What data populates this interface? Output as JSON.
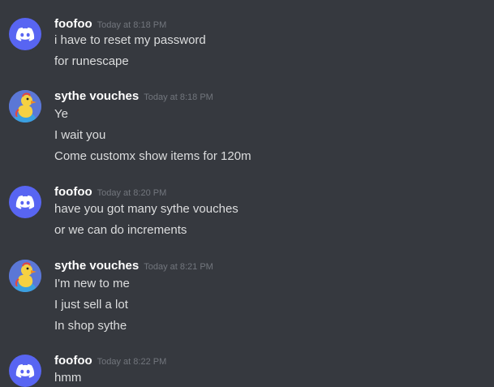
{
  "messages": [
    {
      "avatar": "discord-logo-icon",
      "username": "foofoo",
      "timestamp": "Today at 8:18 PM",
      "lines": [
        "i have to reset my password",
        "for runescape"
      ]
    },
    {
      "avatar": "duck-avatar-icon",
      "username": "sythe vouches",
      "timestamp": "Today at 8:18 PM",
      "lines": [
        "Ye",
        "I wait you",
        "Come customx show items for 120m"
      ]
    },
    {
      "avatar": "discord-logo-icon",
      "username": "foofoo",
      "timestamp": "Today at 8:20 PM",
      "lines": [
        "have you got many sythe vouches",
        "or we can do increments"
      ]
    },
    {
      "avatar": "duck-avatar-icon",
      "username": "sythe vouches",
      "timestamp": "Today at 8:21 PM",
      "lines": [
        "I'm new to me",
        "I just sell a lot",
        "In shop sythe"
      ]
    },
    {
      "avatar": "discord-logo-icon",
      "username": "foofoo",
      "timestamp": "Today at 8:22 PM",
      "lines": [
        "hmm"
      ]
    }
  ],
  "colors": {
    "background": "#36393f",
    "username": "#ffffff",
    "timestamp": "#72767d",
    "message_text": "#dcddde",
    "discord_blurple": "#5865f2"
  }
}
